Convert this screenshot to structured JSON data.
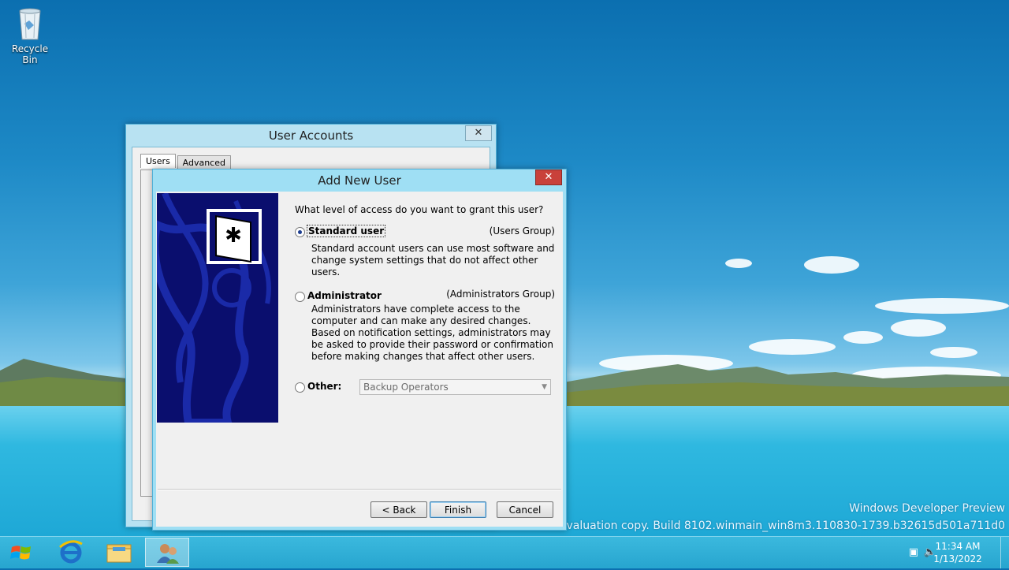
{
  "desktop": {
    "recycle_bin_label": "Recycle Bin"
  },
  "watermark": {
    "line1": "Windows Developer Preview",
    "line2": "Evaluation copy. Build 8102.winmain_win8m3.110830-1739.b32615d501a711d0"
  },
  "user_accounts_window": {
    "title": "User Accounts",
    "close_label": "✕",
    "tabs": [
      {
        "label": "Users"
      },
      {
        "label": "Advanced"
      }
    ]
  },
  "add_user_dialog": {
    "title": "Add New User",
    "close_label": "✕",
    "question": "What level of access do you want to grant this user?",
    "options": {
      "standard": {
        "label": "Standard user",
        "group": "(Users Group)",
        "description": "Standard account users can use most software and change system settings that do not affect other users.",
        "selected": true
      },
      "administrator": {
        "label": "Administrator",
        "group": "(Administrators Group)",
        "description": "Administrators have complete access to the computer and can make any desired changes. Based on notification settings, administrators may be asked to provide their password or confirmation before making changes that affect other users.",
        "selected": false
      },
      "other": {
        "label": "Other:",
        "selected": false,
        "select_value": "Backup Operators"
      }
    },
    "buttons": {
      "back": "< Back",
      "finish": "Finish",
      "cancel": "Cancel"
    }
  },
  "taskbar": {
    "clock_time": "11:34 AM",
    "clock_date": "1/13/2022",
    "apps": [
      {
        "icon": "internet-explorer-icon"
      },
      {
        "icon": "file-explorer-icon"
      },
      {
        "icon": "user-accounts-icon",
        "active": true
      }
    ]
  },
  "colors": {
    "sidebar": "#0a0e6e",
    "taskbar": "#27a5cf",
    "close_button": "#c9413a"
  }
}
